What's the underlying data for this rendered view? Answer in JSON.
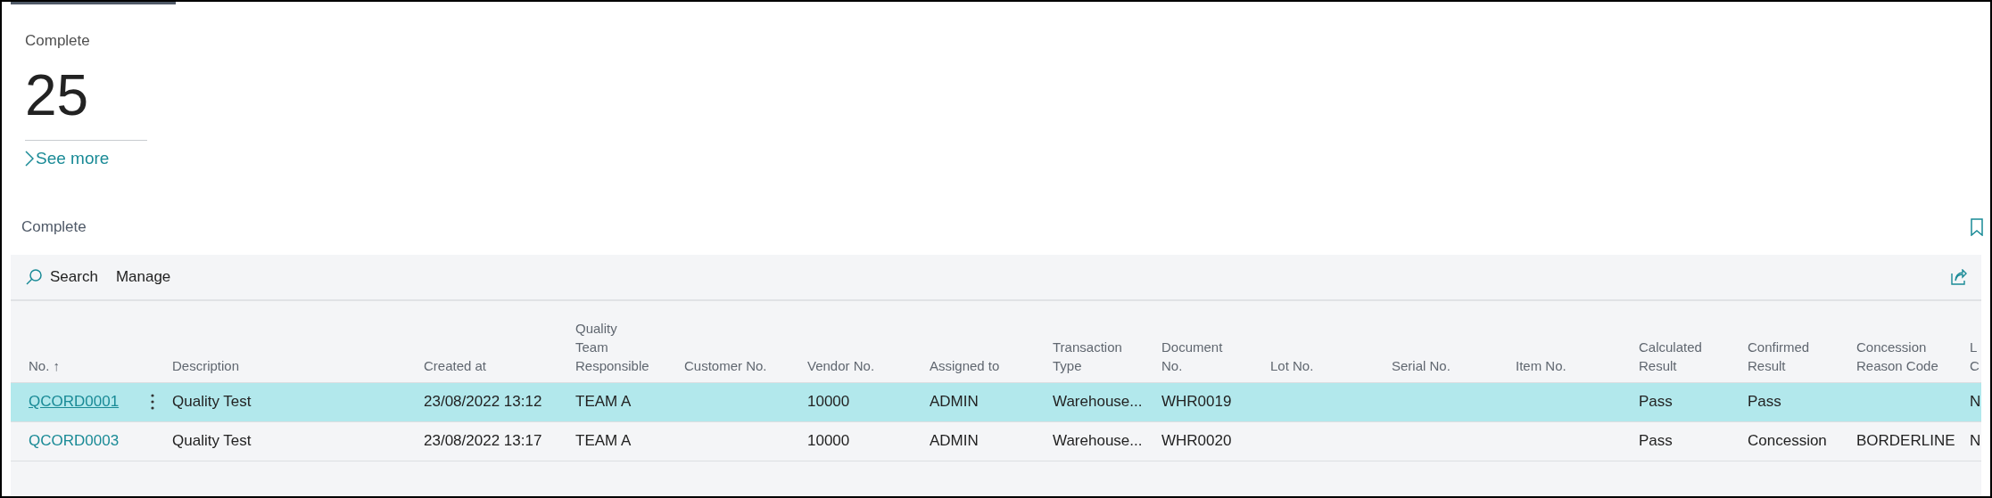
{
  "tile": {
    "title": "Complete",
    "count": "25",
    "link": "See more"
  },
  "list": {
    "title": "Complete",
    "toolbar": [
      "Search",
      "Manage"
    ],
    "columns": [
      {
        "label": "No. ↑"
      },
      {
        "label": "Description"
      },
      {
        "label": "Created at"
      },
      {
        "label": "Quality\nTeam\nResponsible"
      },
      {
        "label": "Customer No."
      },
      {
        "label": "Vendor No."
      },
      {
        "label": "Assigned to"
      },
      {
        "label": "Transaction\nType"
      },
      {
        "label": "Document\nNo."
      },
      {
        "label": "Lot No."
      },
      {
        "label": "Serial No."
      },
      {
        "label": "Item No."
      },
      {
        "label": "Calculated\nResult"
      },
      {
        "label": "Confirmed\nResult"
      },
      {
        "label": "Concession\nReason Code"
      },
      {
        "label": "L\nC"
      }
    ],
    "rows": [
      {
        "selected": true,
        "cells": [
          "QCORD0001",
          "Quality Test",
          "23/08/2022 13:12",
          "TEAM A",
          "",
          "10000",
          "ADMIN",
          "Warehouse...",
          "WHR0019",
          "",
          "",
          "",
          "Pass",
          "Pass",
          "",
          "N"
        ]
      },
      {
        "selected": false,
        "cells": [
          "QCORD0003",
          "Quality Test",
          "23/08/2022 13:17",
          "TEAM A",
          "",
          "10000",
          "ADMIN",
          "Warehouse...",
          "WHR0020",
          "",
          "",
          "",
          "Pass",
          "Concession",
          "BORDERLINE",
          "N"
        ]
      }
    ]
  }
}
